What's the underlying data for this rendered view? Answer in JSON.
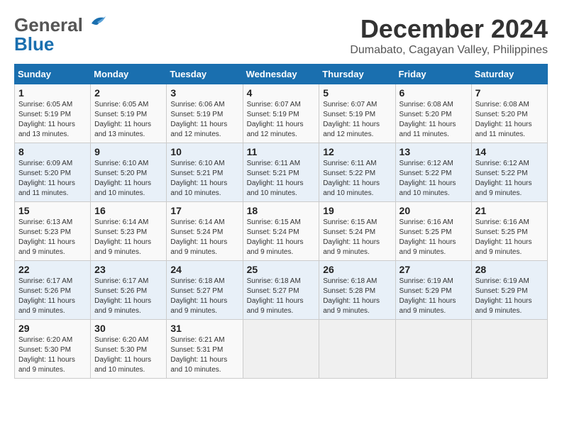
{
  "header": {
    "logo_general": "General",
    "logo_blue": "Blue",
    "main_title": "December 2024",
    "subtitle": "Dumabato, Cagayan Valley, Philippines"
  },
  "calendar": {
    "days_of_week": [
      "Sunday",
      "Monday",
      "Tuesday",
      "Wednesday",
      "Thursday",
      "Friday",
      "Saturday"
    ],
    "weeks": [
      [
        {
          "day": "1",
          "info": "Sunrise: 6:05 AM\nSunset: 5:19 PM\nDaylight: 11 hours\nand 13 minutes."
        },
        {
          "day": "2",
          "info": "Sunrise: 6:05 AM\nSunset: 5:19 PM\nDaylight: 11 hours\nand 13 minutes."
        },
        {
          "day": "3",
          "info": "Sunrise: 6:06 AM\nSunset: 5:19 PM\nDaylight: 11 hours\nand 12 minutes."
        },
        {
          "day": "4",
          "info": "Sunrise: 6:07 AM\nSunset: 5:19 PM\nDaylight: 11 hours\nand 12 minutes."
        },
        {
          "day": "5",
          "info": "Sunrise: 6:07 AM\nSunset: 5:19 PM\nDaylight: 11 hours\nand 12 minutes."
        },
        {
          "day": "6",
          "info": "Sunrise: 6:08 AM\nSunset: 5:20 PM\nDaylight: 11 hours\nand 11 minutes."
        },
        {
          "day": "7",
          "info": "Sunrise: 6:08 AM\nSunset: 5:20 PM\nDaylight: 11 hours\nand 11 minutes."
        }
      ],
      [
        {
          "day": "8",
          "info": "Sunrise: 6:09 AM\nSunset: 5:20 PM\nDaylight: 11 hours\nand 11 minutes."
        },
        {
          "day": "9",
          "info": "Sunrise: 6:10 AM\nSunset: 5:20 PM\nDaylight: 11 hours\nand 10 minutes."
        },
        {
          "day": "10",
          "info": "Sunrise: 6:10 AM\nSunset: 5:21 PM\nDaylight: 11 hours\nand 10 minutes."
        },
        {
          "day": "11",
          "info": "Sunrise: 6:11 AM\nSunset: 5:21 PM\nDaylight: 11 hours\nand 10 minutes."
        },
        {
          "day": "12",
          "info": "Sunrise: 6:11 AM\nSunset: 5:22 PM\nDaylight: 11 hours\nand 10 minutes."
        },
        {
          "day": "13",
          "info": "Sunrise: 6:12 AM\nSunset: 5:22 PM\nDaylight: 11 hours\nand 10 minutes."
        },
        {
          "day": "14",
          "info": "Sunrise: 6:12 AM\nSunset: 5:22 PM\nDaylight: 11 hours\nand 9 minutes."
        }
      ],
      [
        {
          "day": "15",
          "info": "Sunrise: 6:13 AM\nSunset: 5:23 PM\nDaylight: 11 hours\nand 9 minutes."
        },
        {
          "day": "16",
          "info": "Sunrise: 6:14 AM\nSunset: 5:23 PM\nDaylight: 11 hours\nand 9 minutes."
        },
        {
          "day": "17",
          "info": "Sunrise: 6:14 AM\nSunset: 5:24 PM\nDaylight: 11 hours\nand 9 minutes."
        },
        {
          "day": "18",
          "info": "Sunrise: 6:15 AM\nSunset: 5:24 PM\nDaylight: 11 hours\nand 9 minutes."
        },
        {
          "day": "19",
          "info": "Sunrise: 6:15 AM\nSunset: 5:24 PM\nDaylight: 11 hours\nand 9 minutes."
        },
        {
          "day": "20",
          "info": "Sunrise: 6:16 AM\nSunset: 5:25 PM\nDaylight: 11 hours\nand 9 minutes."
        },
        {
          "day": "21",
          "info": "Sunrise: 6:16 AM\nSunset: 5:25 PM\nDaylight: 11 hours\nand 9 minutes."
        }
      ],
      [
        {
          "day": "22",
          "info": "Sunrise: 6:17 AM\nSunset: 5:26 PM\nDaylight: 11 hours\nand 9 minutes."
        },
        {
          "day": "23",
          "info": "Sunrise: 6:17 AM\nSunset: 5:26 PM\nDaylight: 11 hours\nand 9 minutes."
        },
        {
          "day": "24",
          "info": "Sunrise: 6:18 AM\nSunset: 5:27 PM\nDaylight: 11 hours\nand 9 minutes."
        },
        {
          "day": "25",
          "info": "Sunrise: 6:18 AM\nSunset: 5:27 PM\nDaylight: 11 hours\nand 9 minutes."
        },
        {
          "day": "26",
          "info": "Sunrise: 6:18 AM\nSunset: 5:28 PM\nDaylight: 11 hours\nand 9 minutes."
        },
        {
          "day": "27",
          "info": "Sunrise: 6:19 AM\nSunset: 5:29 PM\nDaylight: 11 hours\nand 9 minutes."
        },
        {
          "day": "28",
          "info": "Sunrise: 6:19 AM\nSunset: 5:29 PM\nDaylight: 11 hours\nand 9 minutes."
        }
      ],
      [
        {
          "day": "29",
          "info": "Sunrise: 6:20 AM\nSunset: 5:30 PM\nDaylight: 11 hours\nand 9 minutes."
        },
        {
          "day": "30",
          "info": "Sunrise: 6:20 AM\nSunset: 5:30 PM\nDaylight: 11 hours\nand 10 minutes."
        },
        {
          "day": "31",
          "info": "Sunrise: 6:21 AM\nSunset: 5:31 PM\nDaylight: 11 hours\nand 10 minutes."
        },
        {
          "day": "",
          "info": ""
        },
        {
          "day": "",
          "info": ""
        },
        {
          "day": "",
          "info": ""
        },
        {
          "day": "",
          "info": ""
        }
      ]
    ]
  }
}
